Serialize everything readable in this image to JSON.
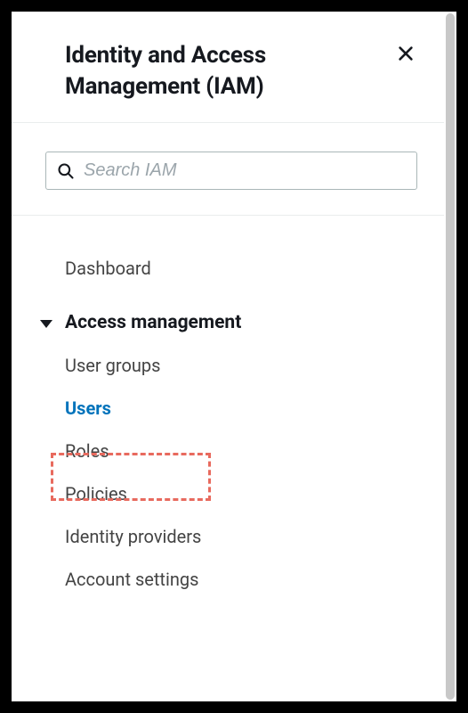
{
  "header": {
    "title": "Identity and Access Management (IAM)"
  },
  "search": {
    "placeholder": "Search IAM"
  },
  "nav": {
    "dashboard": "Dashboard",
    "section": {
      "title": "Access management",
      "items": [
        {
          "label": "User groups"
        },
        {
          "label": "Users"
        },
        {
          "label": "Roles"
        },
        {
          "label": "Policies"
        },
        {
          "label": "Identity providers"
        },
        {
          "label": "Account settings"
        }
      ]
    }
  }
}
